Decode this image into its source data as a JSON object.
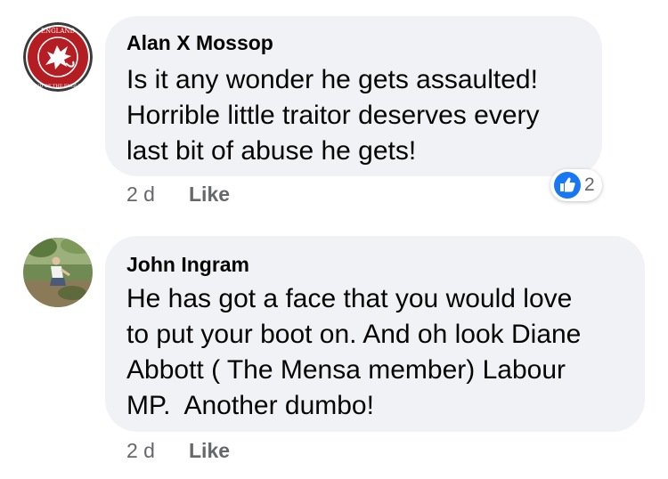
{
  "comments": [
    {
      "author": "Alan X Mossop",
      "text_lines": [
        "Is it any wonder he gets assaulted!",
        "Horrible little traitor deserves every",
        "last bit of abuse he gets!"
      ],
      "time": "2 d",
      "like_label": "Like",
      "reaction": {
        "icon": "thumbs-up-icon",
        "count": "2",
        "color": "#1877f2"
      },
      "avatar": {
        "icon": "england-dragon-badge-icon",
        "badge_top_text": "ENGLAND",
        "badge_bottom_text": "LAND OF THE ENGLISH",
        "color": "#b41e23"
      }
    },
    {
      "author": "John Ingram",
      "text_lines": [
        "He has got a face that you would love",
        "to put your boot on. And oh look Diane",
        "Abbott ( The Mensa member) Labour",
        "MP.  Another dumbo!"
      ],
      "time": "2 d",
      "like_label": "Like",
      "avatar": {
        "icon": "person-photo-icon"
      }
    }
  ],
  "colors": {
    "bubble": "#f0f2f5",
    "text": "#050505",
    "meta": "#65676b",
    "like_blue": "#1877f2"
  }
}
